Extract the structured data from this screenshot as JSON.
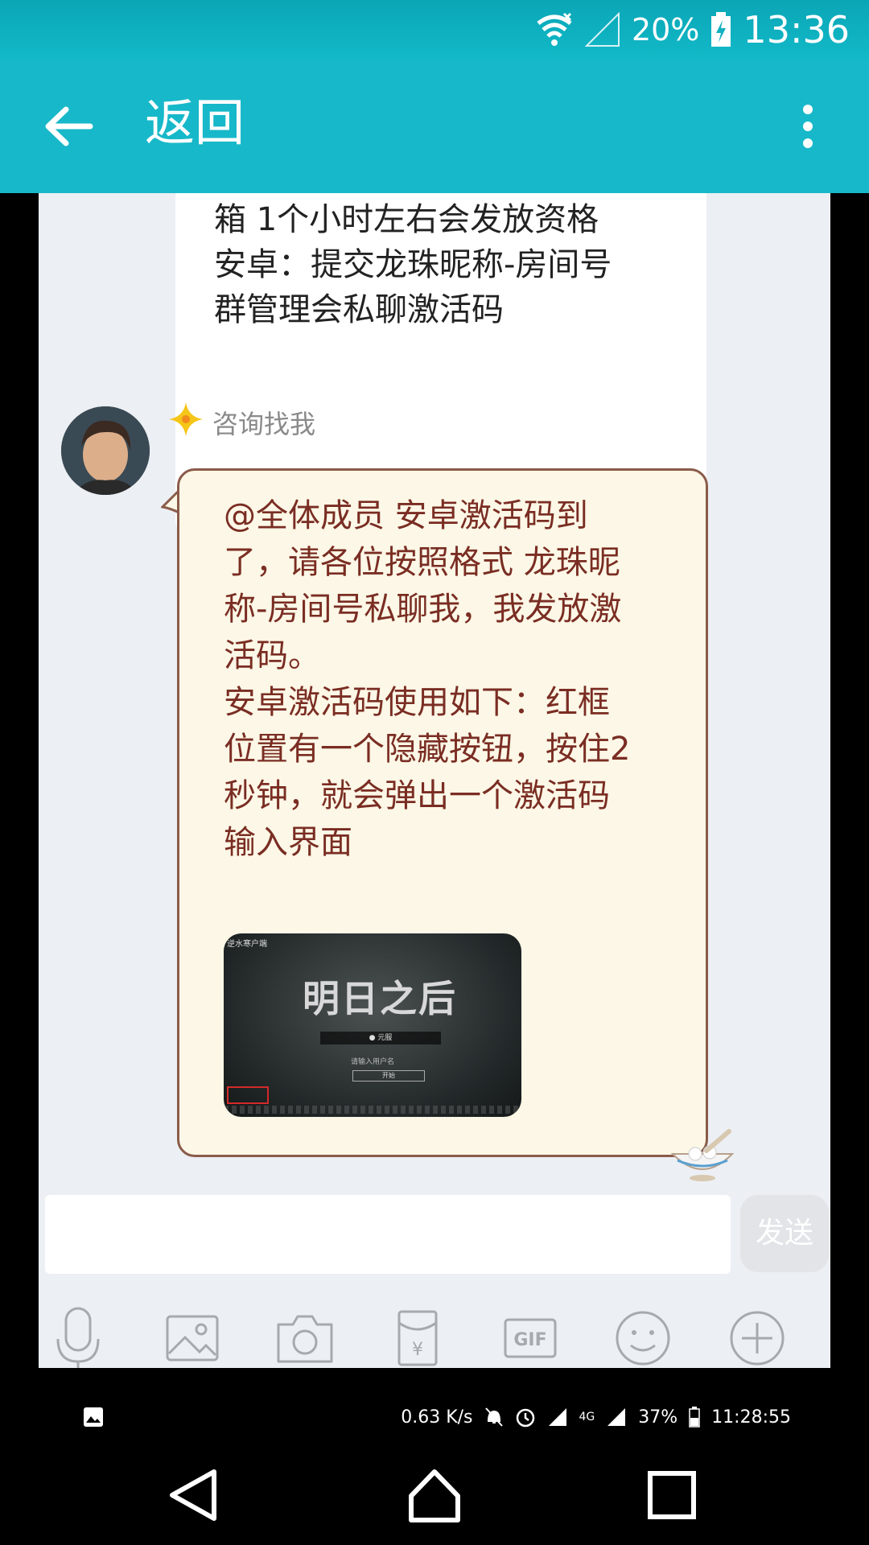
{
  "status_bar": {
    "battery": "20%",
    "time": "13:36"
  },
  "app_bar": {
    "title": "返回"
  },
  "chat": {
    "prev_message": "箱 1个小时左右会发放资格\n安卓：提交龙珠昵称-房间号\n群管理会私聊激活码",
    "sender": {
      "name": "咨询找我",
      "badge_icon": "star-badge-icon"
    },
    "message": "@全体成员 安卓激活码到\n了，请各位按照格式 龙珠昵\n称-房间号私聊我，我发放激\n活码。\n安卓激活码使用如下：红框\n位置有一个隐藏按钮，按住2\n秒钟，就会弹出一个激活码\n输入界面",
    "image": {
      "title": "明日之后",
      "tag": "逆水寒户端",
      "server": "● 元服",
      "user_label": "请输入用户名",
      "start_label": "开始"
    }
  },
  "input": {
    "placeholder": "",
    "send_label": "发送"
  },
  "toolbar": {
    "icons": [
      "microphone-icon",
      "image-icon",
      "camera-icon",
      "red-packet-icon",
      "gif-icon",
      "emoji-icon",
      "plus-icon"
    ]
  },
  "embedded_status": {
    "speed": "0.63 K/s",
    "battery": "37%",
    "time": "11:28:55",
    "network": "4G"
  },
  "colors": {
    "accent": "#17b8c9",
    "bubble_text": "#7a2d23",
    "bubble_bg": "#fcf7e6"
  }
}
